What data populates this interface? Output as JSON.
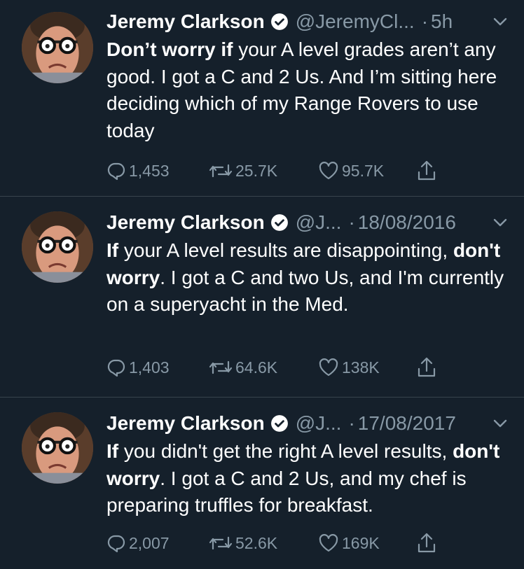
{
  "tweets": [
    {
      "name": "Jeremy Clarkson",
      "handle": "@JeremyCl...",
      "time": "5h",
      "body": [
        {
          "text": "Don’t worry if",
          "bold": true
        },
        {
          "text": " your A level grades aren’t any good. I got a C and 2 Us. And I’m sitting here deciding which of my Range Rovers to use today",
          "bold": false
        }
      ],
      "replies": "1,453",
      "retweets": "25.7K",
      "likes": "95.7K"
    },
    {
      "name": "Jeremy Clarkson",
      "handle": "@J...",
      "time": "18/08/2016",
      "body": [
        {
          "text": "If",
          "bold": true
        },
        {
          "text": " your A level results are disappointing, ",
          "bold": false
        },
        {
          "text": "don't worry",
          "bold": true
        },
        {
          "text": ". I got a C and two Us, and I'm currently on a superyacht in the Med.",
          "bold": false
        }
      ],
      "replies": "1,403",
      "retweets": "64.6K",
      "likes": "138K"
    },
    {
      "name": "Jeremy Clarkson",
      "handle": "@J...",
      "time": "17/08/2017",
      "body": [
        {
          "text": "If",
          "bold": true
        },
        {
          "text": " you didn't get the right A level results, ",
          "bold": false
        },
        {
          "text": "don't worry",
          "bold": true
        },
        {
          "text": ". I got a C and 2 Us, and my chef is preparing  truffles for breakfast.",
          "bold": false
        }
      ],
      "replies": "2,007",
      "retweets": "52.6K",
      "likes": "169K"
    }
  ],
  "colors": {
    "background": "#15202b",
    "secondary_text": "#8899a6",
    "divider": "#38444d"
  },
  "icons": [
    "verified-badge-icon",
    "caret-down-icon",
    "reply-icon",
    "retweet-icon",
    "like-icon",
    "share-icon"
  ]
}
